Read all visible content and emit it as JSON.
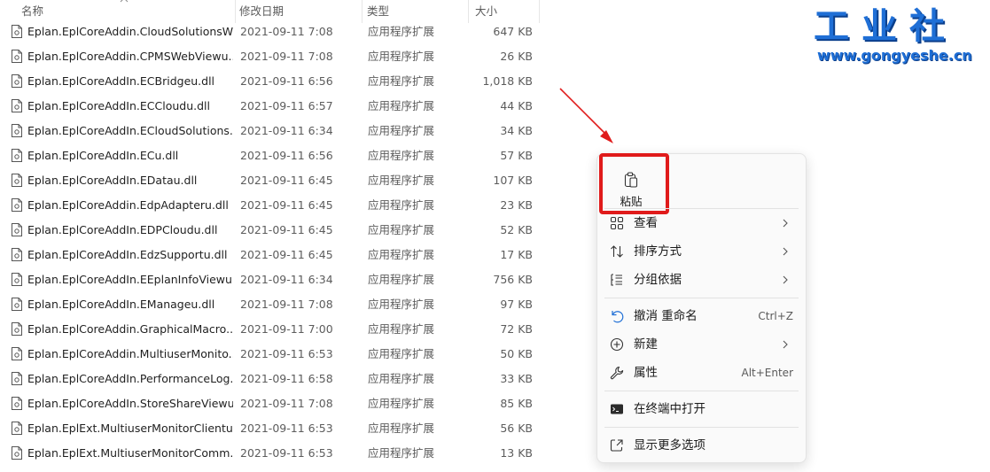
{
  "columns": {
    "name": "名称",
    "date": "修改日期",
    "type": "类型",
    "size": "大小"
  },
  "files": [
    {
      "name": "Eplan.EplCoreAddin.CloudSolutionsW...",
      "date": "2021-09-11 7:08",
      "type": "应用程序扩展",
      "size": "647 KB"
    },
    {
      "name": "Eplan.EplCoreAddin.CPMSWebViewu...",
      "date": "2021-09-11 7:08",
      "type": "应用程序扩展",
      "size": "26 KB"
    },
    {
      "name": "Eplan.EplCoreAddIn.ECBridgeu.dll",
      "date": "2021-09-11 6:56",
      "type": "应用程序扩展",
      "size": "1,018 KB"
    },
    {
      "name": "Eplan.EplCoreAddIn.ECCloudu.dll",
      "date": "2021-09-11 6:57",
      "type": "应用程序扩展",
      "size": "44 KB"
    },
    {
      "name": "Eplan.EplCoreAddIn.ECloudSolutions...",
      "date": "2021-09-11 6:34",
      "type": "应用程序扩展",
      "size": "34 KB"
    },
    {
      "name": "Eplan.EplCoreAddIn.ECu.dll",
      "date": "2021-09-11 6:56",
      "type": "应用程序扩展",
      "size": "57 KB"
    },
    {
      "name": "Eplan.EplCoreAddIn.EDatau.dll",
      "date": "2021-09-11 6:45",
      "type": "应用程序扩展",
      "size": "107 KB"
    },
    {
      "name": "Eplan.EplCoreAddin.EdpAdapteru.dll",
      "date": "2021-09-11 6:45",
      "type": "应用程序扩展",
      "size": "23 KB"
    },
    {
      "name": "Eplan.EplCoreAddIn.EDPCloudu.dll",
      "date": "2021-09-11 6:45",
      "type": "应用程序扩展",
      "size": "52 KB"
    },
    {
      "name": "Eplan.EplCoreAddIn.EdzSupportu.dll",
      "date": "2021-09-11 6:45",
      "type": "应用程序扩展",
      "size": "17 KB"
    },
    {
      "name": "Eplan.EplCoreAddIn.EEplanInfoViewu...",
      "date": "2021-09-11 6:34",
      "type": "应用程序扩展",
      "size": "756 KB"
    },
    {
      "name": "Eplan.EplCoreAddIn.EManageu.dll",
      "date": "2021-09-11 7:08",
      "type": "应用程序扩展",
      "size": "97 KB"
    },
    {
      "name": "Eplan.EplCoreAddin.GraphicalMacro...",
      "date": "2021-09-11 7:00",
      "type": "应用程序扩展",
      "size": "72 KB"
    },
    {
      "name": "Eplan.EplCoreAddin.MultiuserMonito...",
      "date": "2021-09-11 6:53",
      "type": "应用程序扩展",
      "size": "50 KB"
    },
    {
      "name": "Eplan.EplCoreAddIn.PerformanceLog...",
      "date": "2021-09-11 6:58",
      "type": "应用程序扩展",
      "size": "33 KB"
    },
    {
      "name": "Eplan.EplCoreAddIn.StoreShareViewu...",
      "date": "2021-09-11 7:08",
      "type": "应用程序扩展",
      "size": "85 KB"
    },
    {
      "name": "Eplan.EplExt.MultiuserMonitorClientu...",
      "date": "2021-09-11 6:53",
      "type": "应用程序扩展",
      "size": "56 KB"
    },
    {
      "name": "Eplan.EplExt.MultiuserMonitorComm...",
      "date": "2021-09-11 6:53",
      "type": "应用程序扩展",
      "size": "13 KB"
    }
  ],
  "menu": {
    "paste": "粘贴",
    "view": "查看",
    "sort": "排序方式",
    "group": "分组依据",
    "undo": "撤消 重命名",
    "undo_shortcut": "Ctrl+Z",
    "new": "新建",
    "properties": "属性",
    "properties_shortcut": "Alt+Enter",
    "terminal": "在终端中打开",
    "more": "显示更多选项"
  },
  "watermark": {
    "title": "工业社",
    "url": "www.gongyeshe.cn"
  },
  "colors": {
    "highlight": "#e01b1b",
    "watermark": "#1f6fd6"
  }
}
